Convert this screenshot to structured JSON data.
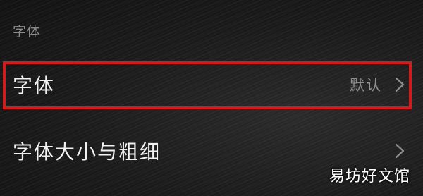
{
  "section": {
    "header": "字体"
  },
  "rows": [
    {
      "label": "字体",
      "value": "默认",
      "icon": "chevron-right-icon"
    },
    {
      "label": "字体大小与粗细",
      "icon": "chevron-right-icon"
    }
  ],
  "highlight_color": "#d31b1b",
  "watermark": "易坊好文馆"
}
